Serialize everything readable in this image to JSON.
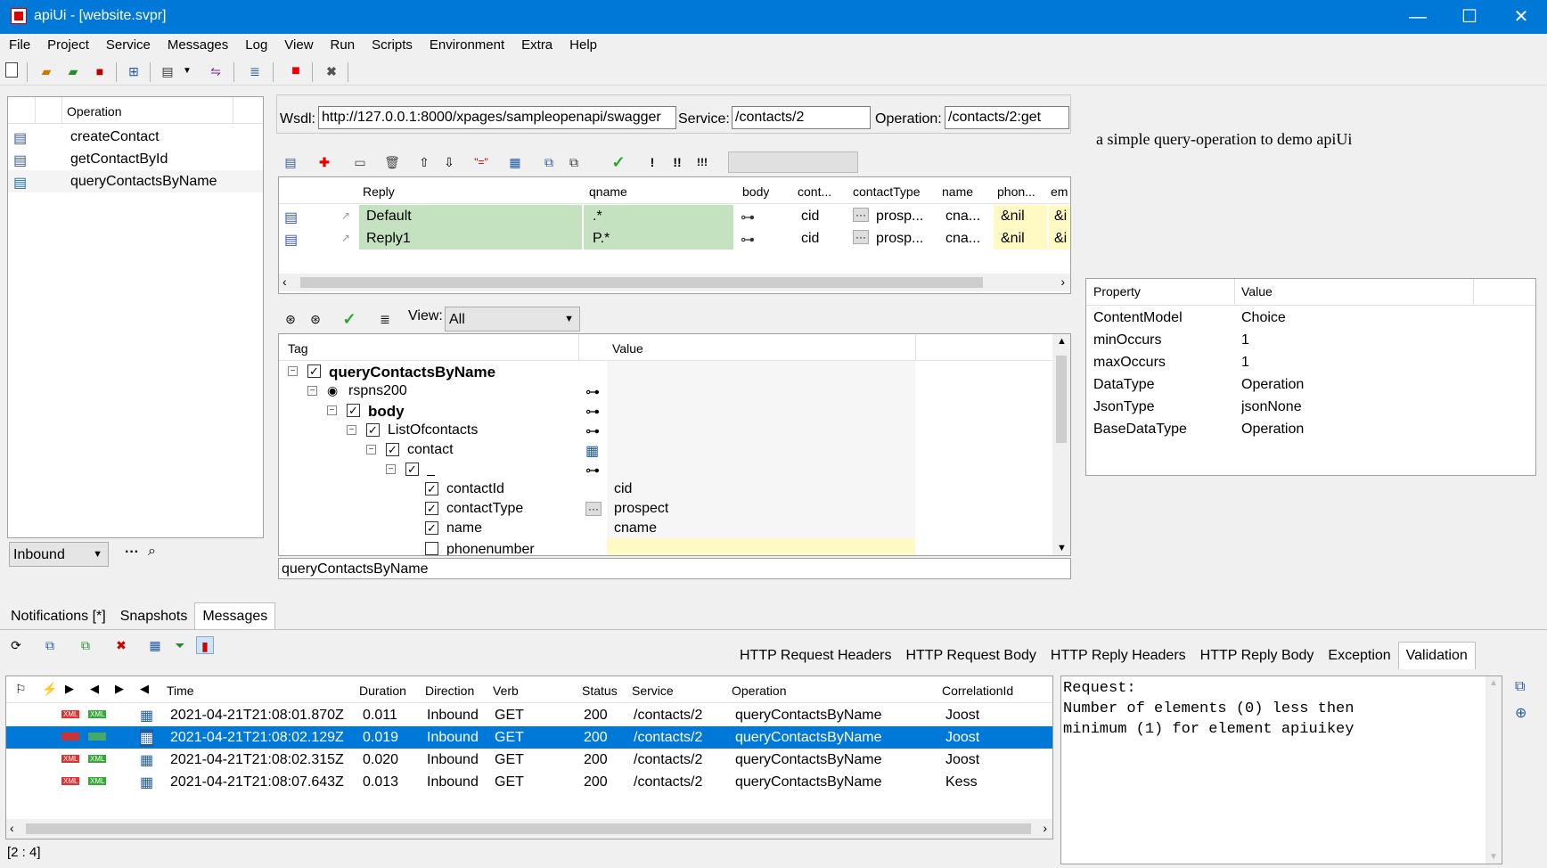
{
  "window": {
    "title": "apiUi - [website.svpr]",
    "minimize": "—",
    "maximize": "☐",
    "close": "✕"
  },
  "menu": [
    "File",
    "Project",
    "Service",
    "Messages",
    "Log",
    "View",
    "Run",
    "Scripts",
    "Environment",
    "Extra",
    "Help"
  ],
  "operations": {
    "header": "Operation",
    "items": [
      "createContact",
      "getContactById",
      "queryContactsByName"
    ],
    "direction": "Inbound",
    "dots": "···"
  },
  "wsdl": {
    "label": "Wsdl:",
    "value": "http://127.0.0.1:8000/xpages/sampleopenapi/swagger",
    "service_label": "Service:",
    "service_value": "/contacts/2",
    "operation_label": "Operation:",
    "operation_value": "/contacts/2:get"
  },
  "replies": {
    "columns": [
      "Reply",
      "qname",
      "body",
      "cont...",
      "contactType",
      "name",
      "phon...",
      "em"
    ],
    "rows": [
      {
        "reply": "Default",
        "qname": ".*",
        "cont": "cid",
        "ctype": "prosp...",
        "name": "cna...",
        "phone": "&nil",
        "em": "&i"
      },
      {
        "reply": "Reply1",
        "qname": "P.*",
        "cont": "cid",
        "ctype": "prosp...",
        "name": "cna...",
        "phone": "&nil",
        "em": "&i"
      }
    ]
  },
  "view": {
    "label": "View:",
    "value": "All"
  },
  "tree": {
    "col_tag": "Tag",
    "col_value": "Value",
    "nodes": [
      {
        "label": "queryContactsByName",
        "value": ""
      },
      {
        "label": "rspns200",
        "value": ""
      },
      {
        "label": "body",
        "value": ""
      },
      {
        "label": "ListOfcontacts",
        "value": ""
      },
      {
        "label": "contact",
        "value": ""
      },
      {
        "label": "_",
        "value": ""
      },
      {
        "label": "contactId",
        "value": "cid"
      },
      {
        "label": "contactType",
        "value": "prospect"
      },
      {
        "label": "name",
        "value": "cname"
      },
      {
        "label": "phonenumber",
        "value": ""
      }
    ],
    "status": "queryContactsByName"
  },
  "description": "a simple query-operation to demo apiUi",
  "properties": {
    "col_property": "Property",
    "col_value": "Value",
    "rows": [
      {
        "k": "ContentModel",
        "v": "Choice"
      },
      {
        "k": "minOccurs",
        "v": "1"
      },
      {
        "k": "maxOccurs",
        "v": "1"
      },
      {
        "k": "DataType",
        "v": "Operation"
      },
      {
        "k": "JsonType",
        "v": "jsonNone"
      },
      {
        "k": "BaseDataType",
        "v": "Operation"
      }
    ]
  },
  "bottom_tabs": [
    "Notifications [*]",
    "Snapshots",
    "Messages"
  ],
  "detail_tabs": [
    "HTTP Request Headers",
    "HTTP Request Body",
    "HTTP Reply Headers",
    "HTTP Reply Body",
    "Exception",
    "Validation"
  ],
  "messages": {
    "columns": [
      "Time",
      "Duration",
      "Direction",
      "Verb",
      "Status",
      "Service",
      "Operation",
      "CorrelationId"
    ],
    "rows": [
      {
        "time": "2021-04-21T21:08:01.870Z",
        "dur": "0.011",
        "dir": "Inbound",
        "verb": "GET",
        "status": "200",
        "svc": "/contacts/2",
        "op": "queryContactsByName",
        "corr": "Joost"
      },
      {
        "time": "2021-04-21T21:08:02.129Z",
        "dur": "0.019",
        "dir": "Inbound",
        "verb": "GET",
        "status": "200",
        "svc": "/contacts/2",
        "op": "queryContactsByName",
        "corr": "Joost"
      },
      {
        "time": "2021-04-21T21:08:02.315Z",
        "dur": "0.020",
        "dir": "Inbound",
        "verb": "GET",
        "status": "200",
        "svc": "/contacts/2",
        "op": "queryContactsByName",
        "corr": "Joost"
      },
      {
        "time": "2021-04-21T21:08:07.643Z",
        "dur": "0.013",
        "dir": "Inbound",
        "verb": "GET",
        "status": "200",
        "svc": "/contacts/2",
        "op": "queryContactsByName",
        "corr": "Kess"
      }
    ],
    "position": "[2 : 4]",
    "xml_tag": "XML"
  },
  "validation_text": "Request:\nNumber of elements (0) less then\nminimum (1) for element apiuikey",
  "colors": {
    "accent": "#0078d7",
    "green_cell": "#c5e2c0",
    "yellow_cell": "#fff9c4"
  }
}
